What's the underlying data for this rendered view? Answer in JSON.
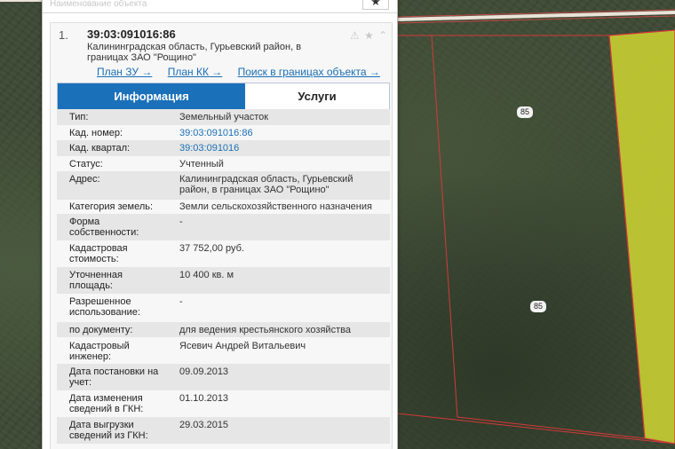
{
  "header": {
    "faded_text": "Наименование объекта",
    "favorite_symbol": "★"
  },
  "result": {
    "number": "1.",
    "cad_number": "39:03:091016:86",
    "address_line1": "Калининградская область, Гурьевский район, в",
    "address_line2": "границах ЗАО \"Рощино\"",
    "icons": "⚠ ★ ⌃"
  },
  "links": {
    "plan_zu": "План ЗУ →",
    "plan_kk": "План КК →",
    "search": "Поиск в границах объекта →"
  },
  "tabs": {
    "info": "Информация",
    "services": "Услуги"
  },
  "rows": [
    {
      "label": "Тип:",
      "value": "Земельный участок"
    },
    {
      "label": "Кад. номер:",
      "value": "39:03:091016:86"
    },
    {
      "label": "Кад. квартал:",
      "value": "39:03:091016"
    },
    {
      "label": "Статус:",
      "value": "Учтенный"
    },
    {
      "label": "Адрес:",
      "value": "Калининградская область, Гурьевский район, в границах ЗАО \"Рощино\""
    },
    {
      "label": "Категория земель:",
      "value": "Земли сельскохозяйственного назначения"
    },
    {
      "label": "Форма собственности:",
      "value": "-"
    },
    {
      "label": "Кадастровая стоимость:",
      "value": "37 752,00 руб."
    },
    {
      "label": "Уточненная площадь:",
      "value": "10 400 кв. м"
    },
    {
      "label": "Разрешенное использование:",
      "value": "-"
    },
    {
      "label": "по документу:",
      "value": "для ведения крестьянского хозяйства"
    },
    {
      "label": "Кадастровый инженер:",
      "value": "Ясевич Андрей Витальевич"
    },
    {
      "label": "Дата постановки на учет:",
      "value": "09.09.2013"
    },
    {
      "label": "Дата изменения сведений в ГКН:",
      "value": "01.10.2013"
    },
    {
      "label": "Дата выгрузки сведений из ГКН:",
      "value": "29.03.2015"
    }
  ],
  "map": {
    "road_labels": [
      "85",
      "85"
    ],
    "highlight_color": "#c6cc32",
    "boundary_color": "#d23a3a"
  }
}
